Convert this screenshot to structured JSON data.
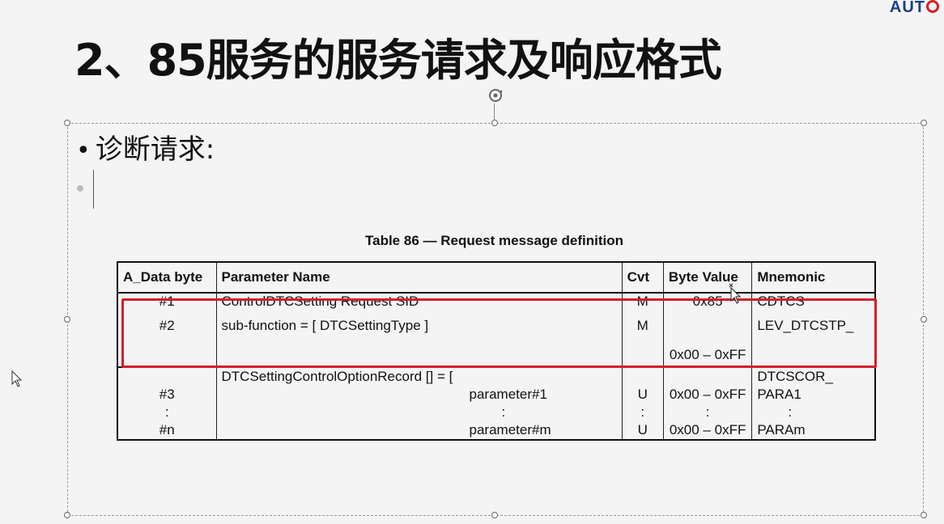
{
  "logo": {
    "text": "AUT"
  },
  "slide": {
    "title": "2、85服务的服务请求及响应格式",
    "bullet1": "诊断请求:"
  },
  "table": {
    "caption": "Table 86 — Request message definition",
    "headers": [
      "A_Data byte",
      "Parameter Name",
      "Cvt",
      "Byte Value",
      "Mnemonic"
    ],
    "row1": {
      "byte": "#1",
      "name": "ControlDTCSetting Request SID",
      "cvt": "M",
      "value": "0x85",
      "mnemonic": "CDTCS"
    },
    "row2": {
      "byte": "#2",
      "name": "sub-function = [ DTCSettingType ]",
      "cvt": "M",
      "value": "0x00 – 0xFF",
      "mnemonic": "LEV_DTCSTP_"
    },
    "row3": {
      "byte_a": "#3",
      "byte_dots": ":",
      "byte_n": "#n",
      "name_head": "DTCSettingControlOptionRecord [] = [",
      "param_1": "parameter#1",
      "param_dots": ":",
      "param_m": "parameter#m",
      "cvt_a": "U",
      "cvt_dots": ":",
      "cvt_n": "U",
      "value_a": "0x00 – 0xFF",
      "value_dots": ":",
      "value_n": "0x00 – 0xFF",
      "mn_head": "DTCSCOR_",
      "mn_a": "PARA1",
      "mn_dots": ":",
      "mn_n": "PARAm"
    }
  },
  "colors": {
    "highlight": "#d0202a",
    "logo_blue": "#1c3f86"
  }
}
